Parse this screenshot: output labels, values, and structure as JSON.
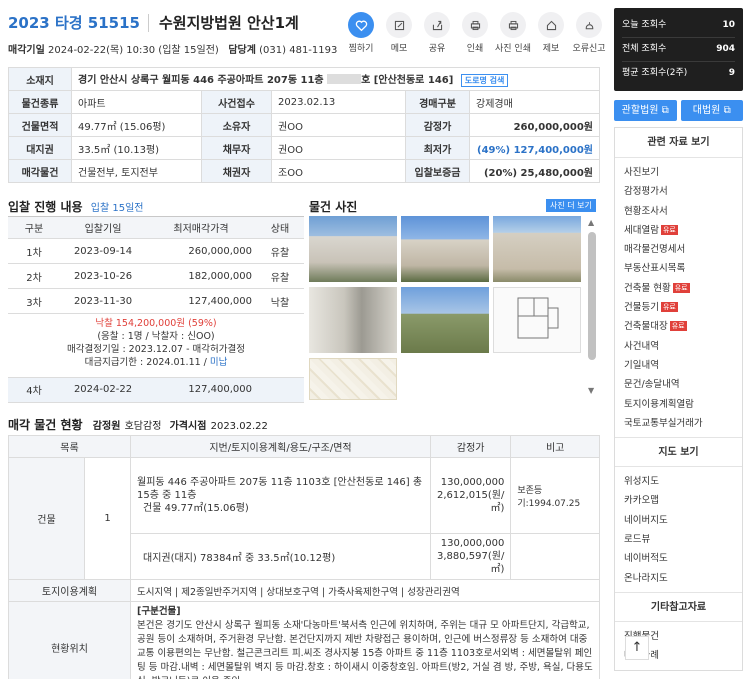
{
  "header": {
    "case_no": "2023 타경 51515",
    "court": "수원지방법원 안산1계",
    "sale_date_label": "매각기일",
    "sale_date": "2024-02-22(목) 10:30 (입찰 15일전)",
    "manager_label": "담당계",
    "manager_phone": "(031) 481-1193"
  },
  "actions": [
    {
      "label": "찜하기",
      "icon": "heart-icon"
    },
    {
      "label": "메모",
      "icon": "memo-icon"
    },
    {
      "label": "공유",
      "icon": "share-icon"
    },
    {
      "label": "인쇄",
      "icon": "print-icon"
    },
    {
      "label": "사진 인쇄",
      "icon": "photo-print-icon"
    },
    {
      "label": "제보",
      "icon": "report-icon"
    },
    {
      "label": "오류신고",
      "icon": "error-icon"
    }
  ],
  "info": {
    "address_label": "소재지",
    "address": "경기 안산시 상록구 월피동 446 주공아파트 207동 11층",
    "address_suffix": "호 [안산천동로 146]",
    "road_btn": "도로명 검색",
    "type_label": "물건종류",
    "type": "아파트",
    "received_label": "사건접수",
    "received": "2023.02.13",
    "auction_type_label": "경매구분",
    "auction_type": "강제경매",
    "area_label": "건물면적",
    "area": "49.77㎡ (15.06평)",
    "owner_label": "소유자",
    "owner": "권OO",
    "appraisal_label": "감정가",
    "appraisal": "260,000,000원",
    "land_label": "대지권",
    "land": "33.5㎡ (10.13평)",
    "debtor_label": "채무자",
    "debtor": "권OO",
    "min_label": "최저가",
    "min": "(49%) 127,400,000원",
    "sale_obj_label": "매각물건",
    "sale_obj": "건물전부, 토지전부",
    "creditor_label": "채권자",
    "creditor": "조OO",
    "deposit_label": "입찰보증금",
    "deposit": "(20%) 25,480,000원"
  },
  "bid": {
    "title": "입찰 진행 내용",
    "days": "입찰 15일전",
    "headers": [
      "구분",
      "입찰기일",
      "최저매각가격",
      "상태"
    ],
    "rows": [
      {
        "round": "1차",
        "date": "2023-09-14",
        "price": "260,000,000",
        "status": "유찰"
      },
      {
        "round": "2차",
        "date": "2023-10-26",
        "price": "182,000,000",
        "status": "유찰"
      },
      {
        "round": "3차",
        "date": "2023-11-30",
        "price": "127,400,000",
        "status": "낙찰"
      }
    ],
    "result_line1": "낙찰 154,200,000원 (59%)",
    "result_line2": "(응찰 : 1명 / 낙찰자 : 신OO)",
    "result_line3": "매각결정기일 : 2023.12.07 - 매각허가결정",
    "result_line4_a": "대금지급기한 : 2024.01.11 / ",
    "result_line4_b": "미납",
    "row4": {
      "round": "4차",
      "date": "2024-02-22",
      "price": "127,400,000",
      "status": ""
    }
  },
  "photos": {
    "title": "물건 사진",
    "more": "사진 더 보기"
  },
  "goods": {
    "title": "매각 물건 현황",
    "appraiser_label": "감정원",
    "appraiser": "호담감정",
    "price_date_label": "가격시점",
    "price_date": "2023.02.22",
    "headers": [
      "목록",
      "지번/토지이용계획/용도/구조/면적",
      "감정가",
      "비고"
    ],
    "building_label": "건물",
    "building_no": "1",
    "building_desc1": "월피동 446 주공아파트 207동 11층 1103호 [안산천동로 146] 총 15층 중 11층",
    "building_desc2": "건물 49.77㎡(15.06평)",
    "building_price": "130,000,000",
    "building_unit": "2,612,015(원/㎡)",
    "building_note": "보존등기:1994.07.25",
    "land_desc": "대지권(대지) 78384㎡ 중 33.5㎡(10.12평)",
    "land_price": "130,000,000",
    "land_unit": "3,880,597(원/㎡)",
    "plan_label": "토지이용계획",
    "plan": "도시지역 | 제2종일반주거지역 | 상대보호구역 | 가축사육제한구역 | 성장관리권역",
    "loc_label": "현황위치",
    "loc_title": "[구분건물]",
    "loc_text": "본건은 경기도 안산시 상록구 월피동 소재'다농마트'북서측 인근에 위치하며, 주위는 대규 모 아파트단지, 각급학교, 공원 등이 소재하며, 주거환경 무난함. 본건단지까지 제반 차량접근 용이하며, 인근에 버스정류장 등 소재하여 대중교통 이용편의는 무난함. 철근콘크리트 피.씨조 경사지붕 15층 아파트 중 11층 1103호로서외벽 : 세면몰탈위 페인팅 등 마감.내벽 : 세면몰탈위 벽지 등 마감.창호 : 하이새시 이중창호임. 아파트(방2, 거실 겸 방, 주방, 욕실, 다용도실, 발코니등)로 이용 중임."
  },
  "sidebar": {
    "stats": [
      {
        "label": "오늘 조회수",
        "value": "10"
      },
      {
        "label": "전체 조회수",
        "value": "904"
      },
      {
        "label": "평균 조회수(2주)",
        "value": "9"
      }
    ],
    "court_btn1": "관할법원",
    "court_btn2": "대법원",
    "related_title": "관련 자료 보기",
    "related": [
      {
        "label": "사진보기",
        "tag": ""
      },
      {
        "label": "감정평가서",
        "tag": ""
      },
      {
        "label": "현황조사서",
        "tag": ""
      },
      {
        "label": "세대열람",
        "tag": "유료"
      },
      {
        "label": "매각물건명세서",
        "tag": ""
      },
      {
        "label": "부동산표시목록",
        "tag": ""
      },
      {
        "label": "건축물 현황",
        "tag": "유료"
      },
      {
        "label": "건물등기",
        "tag": "유료"
      },
      {
        "label": "건축물대장",
        "tag": "유료"
      },
      {
        "label": "사건내역",
        "tag": ""
      },
      {
        "label": "기일내역",
        "tag": ""
      },
      {
        "label": "문건/송달내역",
        "tag": ""
      },
      {
        "label": "토지이용계획열람",
        "tag": ""
      },
      {
        "label": "국토교통부실거래가",
        "tag": ""
      }
    ],
    "map_title": "지도 보기",
    "maps": [
      "위성지도",
      "카카오맵",
      "네이버지도",
      "로드뷰",
      "네이버적도",
      "온나라지도"
    ],
    "etc_title": "기타참고자료",
    "etc": [
      "진행물건",
      "매각사례"
    ]
  },
  "colors": {
    "accent": "#3b8ff0",
    "case_no": "#2b72c7",
    "red": "#e0403a",
    "header_bg": "#eef3f9"
  }
}
